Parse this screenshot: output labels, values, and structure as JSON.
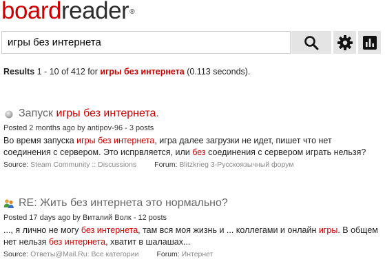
{
  "logo": {
    "part1": "board",
    "part2": "reader",
    "reg": "®"
  },
  "search": {
    "query": "игры без интернета"
  },
  "icons": {
    "search": "search-icon",
    "settings": "gear-icon",
    "stats": "bar-chart-icon"
  },
  "summary": {
    "label": "Results",
    "range": " 1 - 10 of 412 for ",
    "query": "игры без интернета",
    "time": " (0.113 seconds)."
  },
  "results": [
    {
      "icon": "forum-bullet-icon",
      "title_pre": "Запуск ",
      "title_hl": "игры без интернета",
      "title_post": ".",
      "meta": "Posted 2 months ago by antipov-96  - 3 posts",
      "snippet": [
        {
          "t": "Во время запуска ",
          "h": false
        },
        {
          "t": "игры без интернета",
          "h": true
        },
        {
          "t": ", игра далее загрузки не идет, пишет что нет соединения с сервером. Это испрвляется, или ",
          "h": false
        },
        {
          "t": "без",
          "h": true
        },
        {
          "t": " соединения с сервером играть нельзя?",
          "h": false
        }
      ],
      "source_label": "Source:",
      "source_value": "Steam Community :: Discussions",
      "forum_label": "Forum:",
      "forum_value": "Blitzkrieg 3-Русскоязычный форум"
    },
    {
      "icon": "users-icon",
      "title_pre": "RE: Жить без интернета это нормально?",
      "title_hl": "",
      "title_post": "",
      "meta": "Posted 17 days ago by Виталий Волк  - 12 posts",
      "snippet": [
        {
          "t": "..., я лично не могу ",
          "h": false
        },
        {
          "t": "без интернета",
          "h": true
        },
        {
          "t": ", там вся моя жизнь и ... коллегами и онлайн ",
          "h": false
        },
        {
          "t": "игры",
          "h": true
        },
        {
          "t": ". В общем нет нельзя ",
          "h": false
        },
        {
          "t": "без интернета",
          "h": true
        },
        {
          "t": ", хватит в шалашах...",
          "h": false
        }
      ],
      "source_label": "Source:",
      "source_value": "Ответы@Mail.Ru: Все категории",
      "forum_label": "Forum:",
      "forum_value": "Интернет"
    }
  ]
}
